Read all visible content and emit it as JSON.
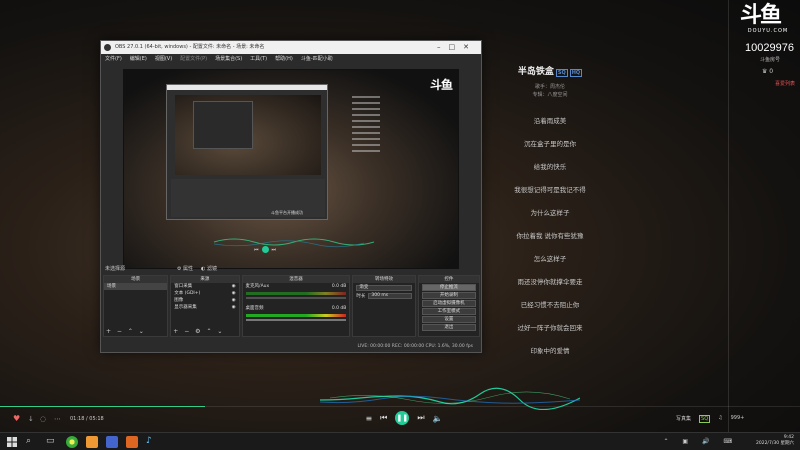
{
  "douyu": {
    "logo": "斗鱼",
    "logo_sub": "DOUYU.COM",
    "room_id": "10029976",
    "room_label": "斗鱼房号",
    "fans": "♛ 0",
    "rank_link": "喜爱列表"
  },
  "song": {
    "title": "半岛铁盒",
    "tag_sq": "SQ",
    "tag_hd": "HQ",
    "singer": "歌手：周杰伦",
    "album": "专辑：八度空间",
    "lyrics": [
      "沿着雨成美",
      "沉在盒子里的是你",
      "给我的快乐",
      "我很想记得可是我记不得",
      "为什么这样子",
      "你拉着我 说你有些犹豫",
      "怎么这样子",
      "雨还没停你就撑伞要走",
      "已经习惯不去阻止你",
      "过好一阵子你就会回来",
      "印象中的爱情"
    ]
  },
  "obs": {
    "title": "OBS 27.0.1 (64-bit, windows) - 配置文件: 未命名 - 场景: 未命名",
    "menu": [
      "文件(F)",
      "编辑(E)",
      "视图(V)",
      "配置文件(P)",
      "场景集合(S)",
      "工具(T)",
      "帮助(H)",
      "斗鱼-匹配小助"
    ],
    "preview_logo": "斗鱼",
    "nested_text": "斗鱼平台开播成功",
    "status_left": "未选择源",
    "mix_props": "⚙ 属性",
    "mix_filters": "◐ 滤镜",
    "docks": {
      "scenes": {
        "header": "场景",
        "items": [
          "场景"
        ]
      },
      "sources": {
        "header": "来源",
        "items": [
          "窗口采集",
          "文本 (GDI+)",
          "图像",
          "显示器采集"
        ]
      },
      "mixer": {
        "header": "混音器",
        "ch1": "麦克风/Aux",
        "ch1_db": "0.0 dB",
        "ch2": "桌面音频",
        "ch2_db": "0.0 dB"
      },
      "transitions": {
        "header": "转场特效",
        "type": "渐变",
        "duration_label": "时长",
        "duration": "300 ms"
      },
      "controls": {
        "header": "控件",
        "buttons": [
          "停止推流",
          "开始录制",
          "启动虚拟摄像机",
          "工作室模式",
          "设置",
          "退出"
        ]
      }
    },
    "statusbar": "LIVE: 00:00:00   REC: 00:00:00   CPU: 1.6%, 30.00 fps"
  },
  "player": {
    "time": "01:18 / 05:18",
    "mini_lyric": "写真集",
    "quality": "SQ",
    "extra": "999+"
  },
  "taskbar": {
    "time": "9:42",
    "date": "2022/7/30 星期六"
  }
}
